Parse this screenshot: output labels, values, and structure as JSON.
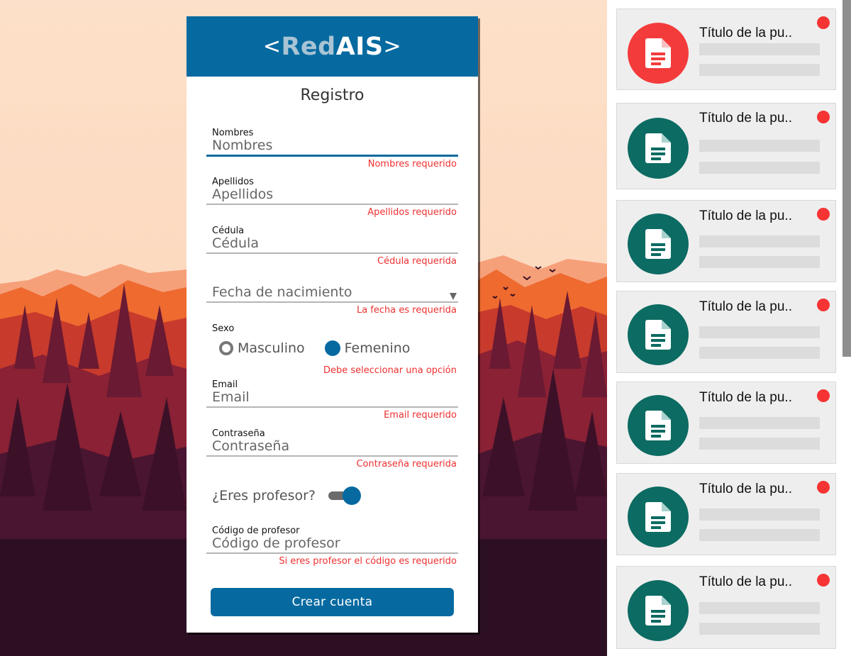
{
  "app": {
    "logo": {
      "open": "<",
      "part1": "Red",
      "part2": "AIS",
      "close": ">"
    },
    "form_title": "Registro"
  },
  "form": {
    "nombres": {
      "label": "Nombres",
      "placeholder": "Nombres",
      "error": "Nombres requerido"
    },
    "apellidos": {
      "label": "Apellidos",
      "placeholder": "Apellidos",
      "error": "Apellidos requerido"
    },
    "cedula": {
      "label": "Cédula",
      "placeholder": "Cédula",
      "error": "Cédula requerida"
    },
    "fecha": {
      "placeholder": "Fecha de nacimiento",
      "error": "La fecha es requerida"
    },
    "sexo": {
      "label": "Sexo",
      "options": [
        "Masculino",
        "Femenino"
      ],
      "selected": "Femenino",
      "error": "Debe seleccionar una opción"
    },
    "email": {
      "label": "Email",
      "placeholder": "Email",
      "error": "Email requerido"
    },
    "password": {
      "label": "Contraseña",
      "placeholder": "Contraseña",
      "error": "Contraseña requerida"
    },
    "profesor": {
      "label": "¿Eres profesor?",
      "checked": true
    },
    "codigo": {
      "label": "Código de profesor",
      "placeholder": "Código de profesor",
      "error": "Si eres profesor el código es requerido"
    },
    "submit_label": "Crear cuenta"
  },
  "colors": {
    "primary": "#066aa0",
    "error": "#ee3030",
    "pub_red": "#f43b3b",
    "pub_teal": "#0c6b62",
    "unread_dot": "#f63434"
  },
  "publications": [
    {
      "title": "Título de la pu..",
      "icon": "document-icon",
      "color": "red",
      "unread": true
    },
    {
      "title": "Título de la pu..",
      "icon": "document-icon",
      "color": "teal",
      "unread": true
    },
    {
      "title": "Título de la pu..",
      "icon": "document-icon",
      "color": "teal",
      "unread": true
    },
    {
      "title": "Título de la pu..",
      "icon": "document-icon",
      "color": "teal",
      "unread": true
    },
    {
      "title": "Título de la pu..",
      "icon": "document-icon",
      "color": "teal",
      "unread": true
    },
    {
      "title": "Título de la pu..",
      "icon": "document-icon",
      "color": "teal",
      "unread": true
    },
    {
      "title": "Título de la pu..",
      "icon": "document-icon",
      "color": "teal",
      "unread": true
    }
  ]
}
